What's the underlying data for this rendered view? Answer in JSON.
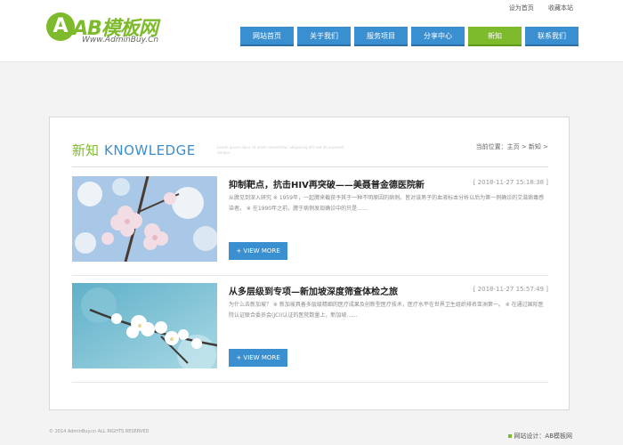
{
  "header": {
    "logo_mark": "A",
    "logo_name": "AB模板网",
    "logo_url": "Www.AdminBuy.Cn",
    "toplinks": [
      "设为首页",
      "收藏本站"
    ],
    "nav": [
      {
        "label": "网站首页",
        "active": false
      },
      {
        "label": "关于我们",
        "active": false
      },
      {
        "label": "服务项目",
        "active": false
      },
      {
        "label": "分享中心",
        "active": false
      },
      {
        "label": "新知",
        "active": true
      },
      {
        "label": "联系我们",
        "active": false
      }
    ]
  },
  "section": {
    "title_cn": "新知",
    "title_en": "KNOWLEDGE",
    "desc": "Lorem ipsum dolor sit amet consectetur adipiscing elit sed do eiusmod tempor",
    "breadcrumb": "当前位置：主页 > 新知 >"
  },
  "articles": [
    {
      "title": "抑制靶点，抗击HIV再突破——美聂普金德医院新",
      "date": "[ 2018-11-27 15:18:38 ]",
      "summary": "从脾见到深入研究 ※ 1959年，一起脾来截获予其于一种不明原因的病例。皆对该男子的血液标本分析以后为第一例确诊的艾滋病毒感染者。 ※ 在1990年之前，脾于病例发现确诊中的只是……",
      "button": "+ VIEW MORE"
    },
    {
      "title": "从多层级到专项—新加坡深度筛查体检之旅",
      "date": "[ 2018-11-27 15:57:49 ]",
      "summary": "为什么去新加坡？ ※ 新加坡具备多层级精细的医疗成果及创新型医疗技术，医疗水平在世界卫生组织排名亚洲第一。 ※ 在通过国际医院认证联合委员会(JCI)认证的医院数量上，新加坡……",
      "button": "+ VIEW MORE"
    }
  ],
  "footer": {
    "copyright": "© 2014 AdminBuy.cn ALL RIGHTS RESERVED",
    "credit": "网站设计：AB模板网"
  },
  "colors": {
    "brand_green": "#7dbb2c",
    "brand_blue": "#3a8fd0"
  }
}
